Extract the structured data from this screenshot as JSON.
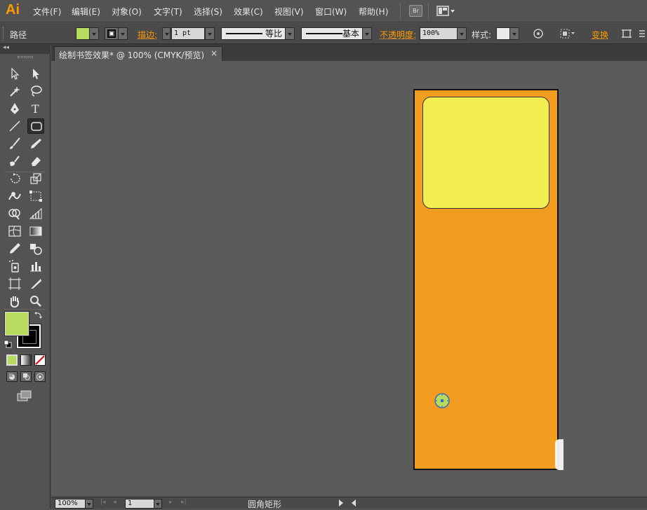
{
  "app": {
    "logo": "Ai"
  },
  "menu": {
    "items": [
      "文件(F)",
      "编辑(E)",
      "对象(O)",
      "文字(T)",
      "选择(S)",
      "效果(C)",
      "视图(V)",
      "窗口(W)",
      "帮助(H)"
    ],
    "bridge_label": "Br"
  },
  "control_bar": {
    "object_type": "路径",
    "fill_color": "#b6db5e",
    "stroke_label": "描边:",
    "stroke_weight": "1 pt",
    "profile_label": "等比",
    "brush_label": "基本",
    "opacity_label": "不透明度:",
    "opacity_value": "100%",
    "style_label": "样式:",
    "transform_label": "变换"
  },
  "document": {
    "tab_title": "绘制书签效果* @ 100% (CMYK/预览)",
    "close": "×"
  },
  "colors": {
    "fill": "#b6db5e",
    "stroke": "#000000",
    "bookmark": "#f29d1f",
    "panel": "#f2ed50",
    "accent": "#ff9a00"
  },
  "status_bar": {
    "zoom": "100%",
    "artboard": "1",
    "tool_name": "圆角矩形"
  },
  "icons": [
    "selection-icon",
    "direct-selection-icon",
    "magic-wand-icon",
    "lasso-icon",
    "pen-icon",
    "type-icon",
    "line-icon",
    "rounded-rectangle-icon",
    "paintbrush-icon",
    "pencil-icon",
    "blob-brush-icon",
    "eraser-icon",
    "rotate-icon",
    "scale-icon",
    "warp-icon",
    "free-transform-icon",
    "shape-builder-icon",
    "perspective-icon",
    "mesh-icon",
    "gradient-icon",
    "eyedropper-icon",
    "blend-icon",
    "symbol-sprayer-icon",
    "column-graph-icon",
    "artboard-icon",
    "slice-icon",
    "hand-icon",
    "zoom-icon"
  ]
}
